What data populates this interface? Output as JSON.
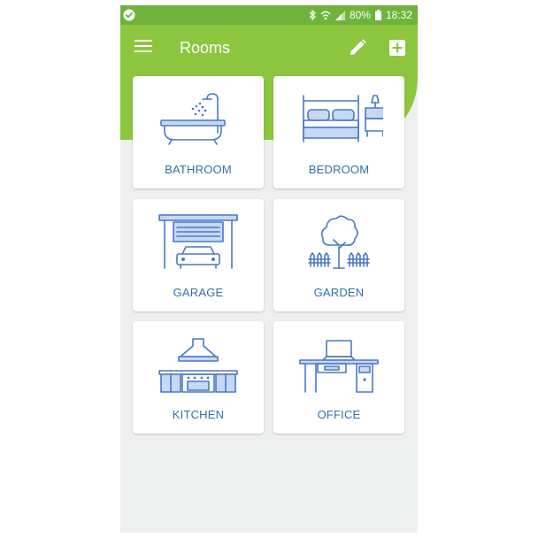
{
  "status_bar": {
    "battery": "80%",
    "time": "18:32"
  },
  "app_bar": {
    "title": "Rooms",
    "menu_icon": "hamburger-menu-icon",
    "edit_icon": "pencil-icon",
    "add_icon": "add-box-icon"
  },
  "rooms": [
    {
      "label": "BATHROOM",
      "icon": "bathtub-icon"
    },
    {
      "label": "BEDROOM",
      "icon": "bed-icon"
    },
    {
      "label": "GARAGE",
      "icon": "garage-icon"
    },
    {
      "label": "GARDEN",
      "icon": "garden-icon"
    },
    {
      "label": "KITCHEN",
      "icon": "kitchen-icon"
    },
    {
      "label": "OFFICE",
      "icon": "office-desk-icon"
    }
  ],
  "colors": {
    "accent": "#8cc63f",
    "status_bar": "#6fb33a",
    "label": "#2f6fb0",
    "icon": "#4a78c8",
    "background": "#eeefef"
  }
}
